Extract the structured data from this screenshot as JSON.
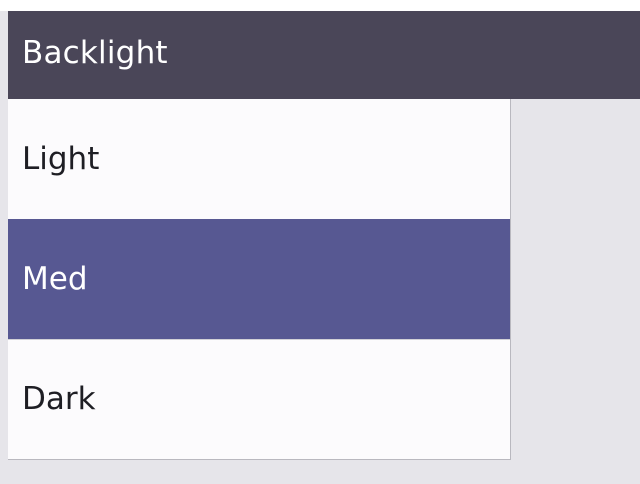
{
  "screen": {
    "title": "Backlight"
  },
  "options": {
    "items": [
      {
        "label": "Light"
      },
      {
        "label": "Med"
      },
      {
        "label": "Dark"
      }
    ],
    "selected": "Med"
  },
  "colors": {
    "header_bg": "#4a4658",
    "header_text": "#ffffff",
    "list_bg": "#fcfbfd",
    "selected_bg": "#575892",
    "selected_text": "#ffffff",
    "item_text": "#1e1e24",
    "screen_bg": "#e6e5ea"
  }
}
